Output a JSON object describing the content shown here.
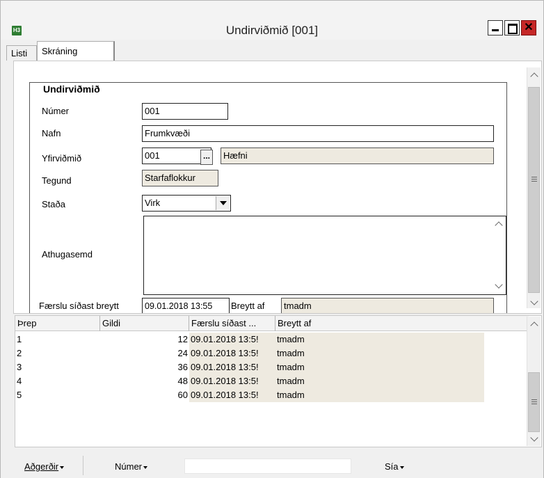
{
  "window": {
    "icon_text": "H3",
    "title": "Undirviðmið [001]",
    "minimize": "_",
    "maximize": "□",
    "close": "✕"
  },
  "tabs": [
    {
      "label": "Listi"
    },
    {
      "label": "Skráning"
    }
  ],
  "form": {
    "group_title": "Undirviðmið",
    "numer_label": "Númer",
    "numer_value": "001",
    "nafn_label": "Nafn",
    "nafn_value": "Frumkvæði",
    "yfirvidmid_label": "Yfirviðmið",
    "yfirvidmid_code": "001",
    "yfirvidmid_button": "...",
    "yfirvidmid_name": "Hæfni",
    "tegund_label": "Tegund",
    "tegund_value": "Starfaflokkur",
    "stada_label": "Staða",
    "stada_value": "Virk",
    "athugasemd_label": "Athugasemd",
    "athugasemd_value": "",
    "faerslu_label": "Færslu síðast breytt",
    "faerslu_value": "09.01.2018 13:55",
    "breytt_label": "Breytt af",
    "breytt_value": "tmadm"
  },
  "grid": {
    "columns": [
      "Þrep",
      "Gildi",
      "Færslu síðast ...",
      "Breytt af"
    ],
    "rows": [
      {
        "threp": "1",
        "gildi": "12",
        "faerslu": "09.01.2018 13:5!",
        "breytt": "tmadm"
      },
      {
        "threp": "2",
        "gildi": "24",
        "faerslu": "09.01.2018 13:5!",
        "breytt": "tmadm"
      },
      {
        "threp": "3",
        "gildi": "36",
        "faerslu": "09.01.2018 13:5!",
        "breytt": "tmadm"
      },
      {
        "threp": "4",
        "gildi": "48",
        "faerslu": "09.01.2018 13:5!",
        "breytt": "tmadm"
      },
      {
        "threp": "5",
        "gildi": "60",
        "faerslu": "09.01.2018 13:5!",
        "breytt": "tmadm"
      }
    ]
  },
  "statusbar": {
    "adgerdir": "Aðgerðir",
    "numer": "Númer",
    "search_value": "",
    "sia": "Sía"
  },
  "colors": {
    "readonly_bg": "#eeeae0",
    "close_red": "#c62828"
  }
}
